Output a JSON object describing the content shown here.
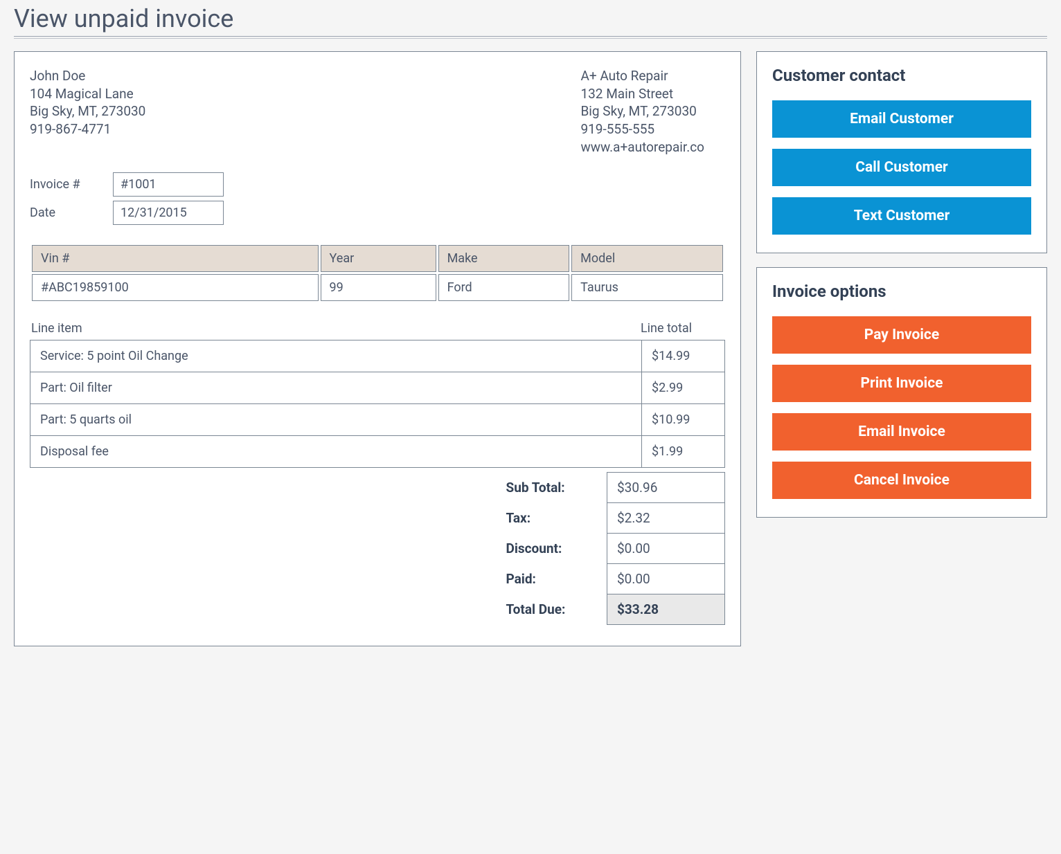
{
  "page": {
    "title": "View unpaid invoice"
  },
  "customer": {
    "name": "John Doe",
    "street": "104 Magical Lane",
    "city_line": "Big Sky, MT, 273030",
    "phone": "919-867-4771"
  },
  "company": {
    "name": "A+ Auto Repair",
    "street": "132 Main Street",
    "city_line": "Big Sky, MT, 273030",
    "phone": "919-555-555",
    "website": "www.a+autorepair.co"
  },
  "meta": {
    "invoice_label": "Invoice #",
    "invoice_value": "#1001",
    "date_label": "Date",
    "date_value": "12/31/2015"
  },
  "vehicle": {
    "headers": {
      "vin": "Vin #",
      "year": "Year",
      "make": "Make",
      "model": "Model"
    },
    "row": {
      "vin": "#ABC19859100",
      "year": "99",
      "make": "Ford",
      "model": "Taurus"
    }
  },
  "lines": {
    "header_item": "Line item",
    "header_total": "Line total",
    "rows": [
      {
        "item": "Service: 5 point Oil Change",
        "total": "$14.99"
      },
      {
        "item": "Part: Oil filter",
        "total": "$2.99"
      },
      {
        "item": "Part: 5 quarts oil",
        "total": "$10.99"
      },
      {
        "item": "Disposal fee",
        "total": "$1.99"
      }
    ]
  },
  "totals": {
    "subtotal_label": "Sub Total:",
    "subtotal_value": "$30.96",
    "tax_label": "Tax:",
    "tax_value": "$2.32",
    "discount_label": "Discount:",
    "discount_value": "$0.00",
    "paid_label": "Paid:",
    "paid_value": "$0.00",
    "due_label": "Total Due:",
    "due_value": "$33.28"
  },
  "sidebar": {
    "contact": {
      "title": "Customer contact",
      "email": "Email Customer",
      "call": "Call Customer",
      "text": "Text Customer"
    },
    "options": {
      "title": "Invoice options",
      "pay": "Pay Invoice",
      "print": "Print Invoice",
      "email": "Email Invoice",
      "cancel": "Cancel Invoice"
    }
  }
}
